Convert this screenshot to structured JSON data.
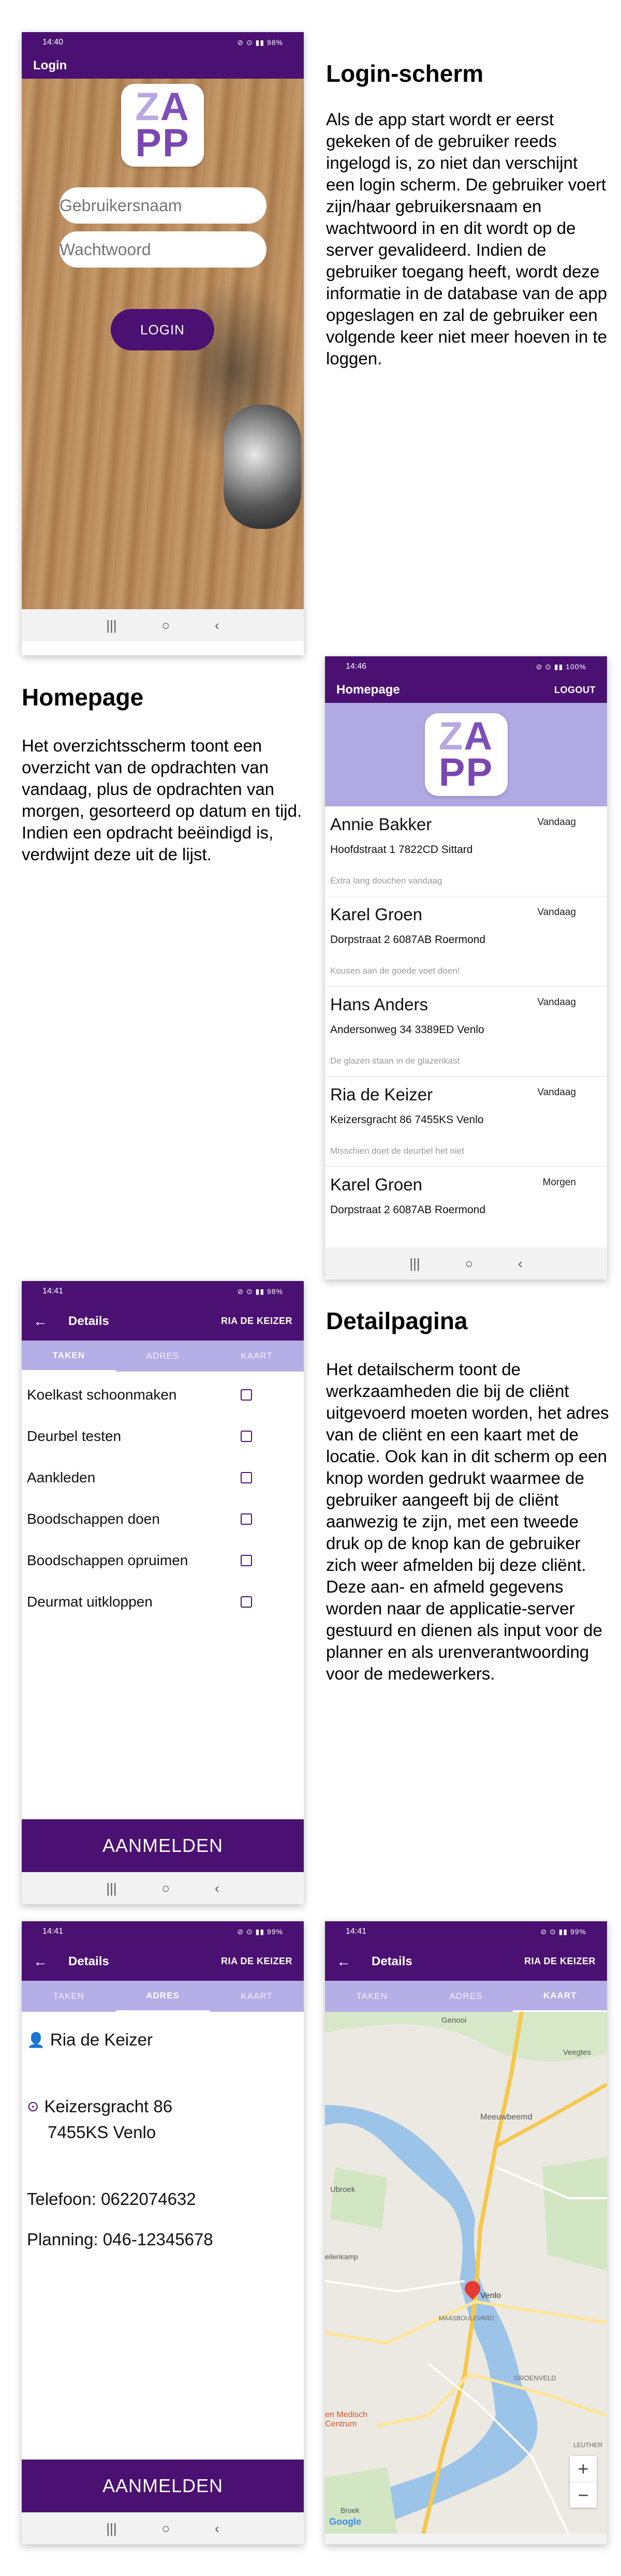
{
  "login_section": {
    "title": "Login-scherm",
    "text": "Als de app start wordt er eerst gekeken of de gebruiker reeds ingelogd is, zo niet dan verschijnt een login scherm. De gebruiker voert zijn/haar gebruikersnaam en wachtwoord in en dit wordt op de server gevalideerd. Indien de gebruiker toegang heeft, wordt deze informatie in de database van de app opgeslagen en zal de gebruiker een volgende keer niet meer hoeven in te loggen."
  },
  "login_phone": {
    "time": "14:40",
    "status": "98%",
    "app_title": "Login",
    "username_placeholder": "Gebruikersnaam",
    "password_placeholder": "Wachtwoord",
    "login_button": "LOGIN"
  },
  "logo": {
    "row1": [
      "Z",
      "A"
    ],
    "row2": [
      "P",
      "P"
    ]
  },
  "home_section": {
    "title": "Homepage",
    "text": "Het overzichtsscherm toont een overzicht van de opdrachten van vandaag, plus de opdrachten van morgen, gesorteerd op datum en tijd. Indien een opdracht beëindigd is, verdwijnt deze uit de lijst."
  },
  "home_phone": {
    "time": "14:46",
    "status": "100%",
    "app_title": "Homepage",
    "logout": "LOGOUT",
    "items": [
      {
        "name": "Annie Bakker",
        "address": "Hoofdstraat 1 7822CD Sittard",
        "note": "Extra lang douchen vandaag",
        "date": "Vandaag"
      },
      {
        "name": "Karel Groen",
        "address": "Dorpstraat 2 6087AB Roermond",
        "note": "Kousen aan de goede voet doen!",
        "date": "Vandaag"
      },
      {
        "name": "Hans Anders",
        "address": "Andersonweg 34 3389ED Venlo",
        "note": "De glazen staan in de glazenkast",
        "date": "Vandaag"
      },
      {
        "name": "Ria de Keizer",
        "address": "Keizersgracht 86 7455KS Venlo",
        "note": "Misschien doet de deurbel het niet",
        "date": "Vandaag"
      },
      {
        "name": "Karel Groen",
        "address": "Dorpstraat 2 6087AB Roermond",
        "note": "",
        "date": "Morgen"
      }
    ]
  },
  "detail_section": {
    "title": "Detailpagina",
    "text": "Het detailscherm toont de werkzaamheden die bij de cliënt uitgevoerd moeten worden, het adres van de cliënt en een kaart met de locatie. Ook kan in dit scherm op een knop worden gedrukt waarmee de gebruiker aangeeft bij de cliënt aanwezig te zijn, met een tweede druk op de knop kan de gebruiker zich weer afmelden bij deze cliënt. Deze aan- en afmeld gegevens worden naar de applicatie-server gestuurd en dienen als input voor de planner en als urenverantwoording voor de medewerkers."
  },
  "detail_phone": {
    "time": "14:41",
    "status": "98%",
    "app_title": "Details",
    "client": "RIA DE KEIZER",
    "tabs": [
      "TAKEN",
      "ADRES",
      "KAART"
    ],
    "tasks": [
      "Koelkast schoonmaken",
      "Deurbel testen",
      "Aankleden",
      "Boodschappen doen",
      "Boodschappen opruimen",
      "Deurmat uitkloppen"
    ],
    "button": "AANMELDEN"
  },
  "address_phone": {
    "time": "14:41",
    "status": "99%",
    "app_title": "Details",
    "client": "RIA DE KEIZER",
    "tabs": [
      "TAKEN",
      "ADRES",
      "KAART"
    ],
    "name": "Ria de Keizer",
    "street": "Keizersgracht 86",
    "city": "7455KS Venlo",
    "phone": "Telefoon: 0622074632",
    "planning": "Planning: 046-12345678",
    "button": "AANMELDEN"
  },
  "map_phone": {
    "time": "14:41",
    "status": "99%",
    "app_title": "Details",
    "client": "RIA DE KEIZER",
    "tabs": [
      "TAKEN",
      "ADRES",
      "KAART"
    ],
    "labels": [
      "Genooi",
      "Veegtes",
      "Meeuwbeemd",
      "Ubroek",
      "eilenkamp",
      "Venlo",
      "MAASBOULEVARD",
      "GROENVELD",
      "LEUTHER",
      "Broek",
      "Google",
      "en Medisch Centrum"
    ],
    "zoom_in": "+",
    "zoom_out": "−"
  },
  "colors": {
    "primary": "#4a1172",
    "tab_bar": "#b6aee6",
    "logo_band": "#b1a9e4"
  }
}
